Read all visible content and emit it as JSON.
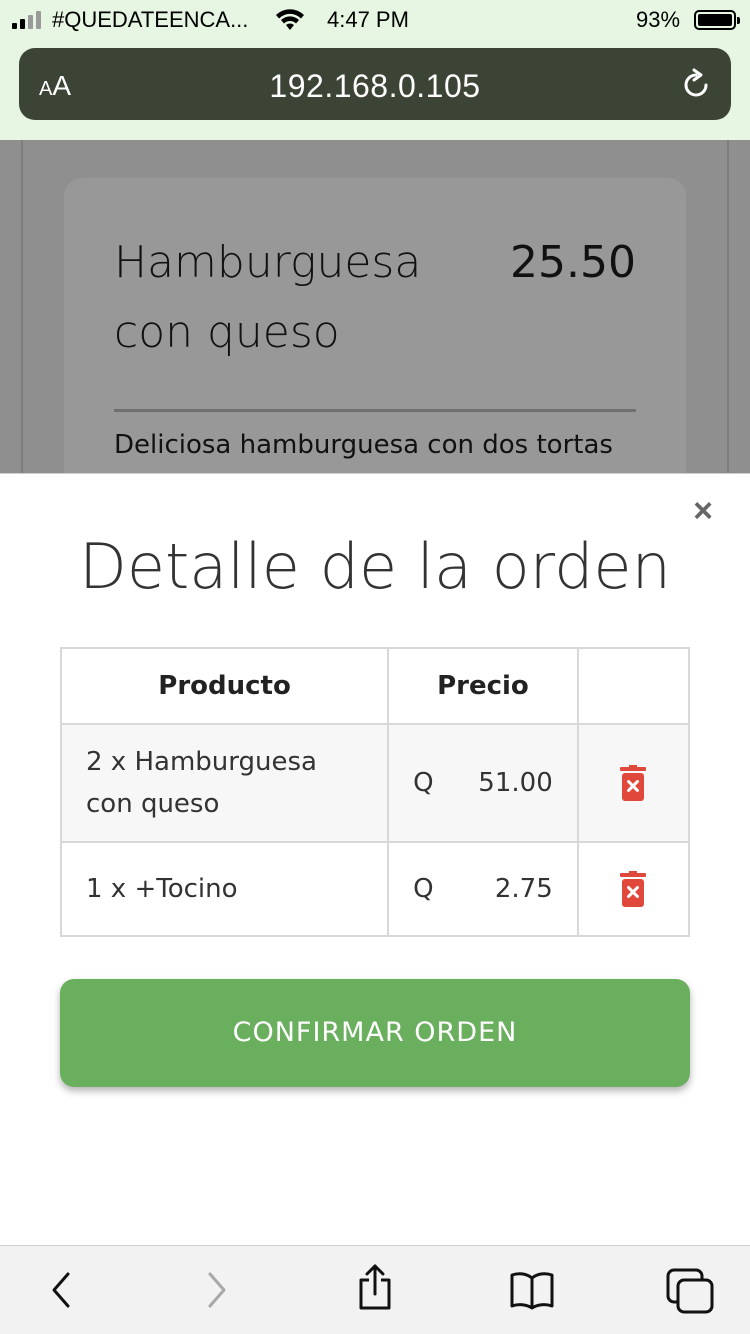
{
  "status_bar": {
    "carrier": "#QUEDATEENCA...",
    "time": "4:47 PM",
    "battery": "93%",
    "battery_level": 0.93,
    "signal_bars": 2
  },
  "browser": {
    "aa_small": "A",
    "aa_large": "A",
    "url": "192.168.0.105",
    "icons": [
      "reload-icon",
      "back-icon",
      "forward-icon",
      "share-icon",
      "bookmarks-icon",
      "tabs-icon"
    ]
  },
  "background_card": {
    "title": "Hamburguesa con queso",
    "price": "25.50",
    "description": "Deliciosa hamburguesa con dos tortas"
  },
  "modal": {
    "close": "×",
    "title": "Detalle de la orden",
    "columns": [
      "Producto",
      "Precio",
      ""
    ],
    "rows": [
      {
        "product": "2 x Hamburguesa con queso",
        "currency": "Q",
        "price": "51.00"
      },
      {
        "product": "1 x +Tocino",
        "currency": "Q",
        "price": "2.75"
      }
    ],
    "confirm_label": "CONFIRMAR ORDEN"
  },
  "colors": {
    "accent": "#69af5d",
    "delete": "#e0483c",
    "browser_bar": "#3c4436",
    "status_bg": "#e6f6e2"
  }
}
